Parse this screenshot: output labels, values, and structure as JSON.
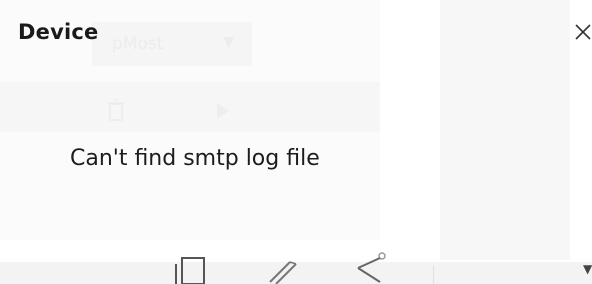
{
  "dialog": {
    "title": "Device",
    "message": "Can't find smtp log file",
    "close_icon": "close-icon"
  },
  "background": {
    "dropdown_value": "pMost",
    "dropdown_prefix": "ost",
    "icons": [
      "trash-icon",
      "play-icon",
      "copy-icon",
      "edit-icon",
      "share-icon",
      "chevron-down-icon"
    ]
  },
  "colors": {
    "text": "#1a1a1a",
    "faded": "#ececec",
    "bar": "#f3f3f3"
  }
}
